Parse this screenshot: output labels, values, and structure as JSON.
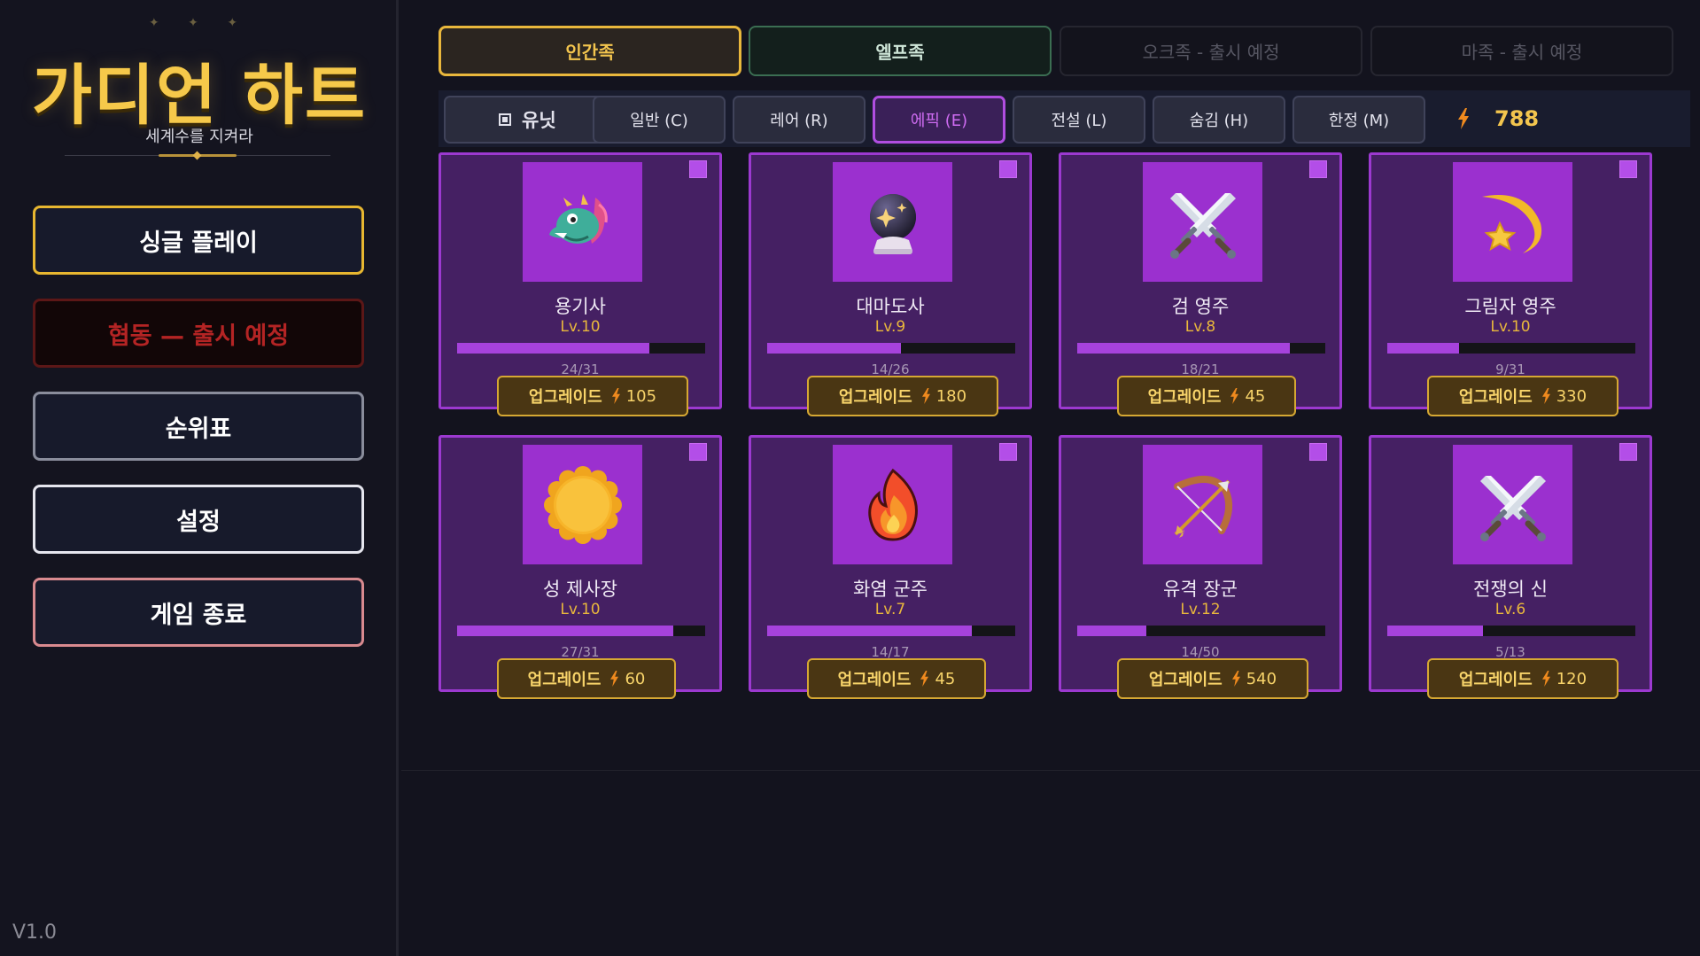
{
  "sidebar": {
    "stars": "✦ ✦ ✦",
    "title": "가디언 하트",
    "subtitle": "세계수를 지켜라",
    "menu": {
      "single": "싱글 플레이",
      "coop": "협동 — 출시 예정",
      "ranking": "순위표",
      "settings": "설정",
      "quit": "게임 종료"
    },
    "version": "V1.0"
  },
  "race_tabs": [
    {
      "label": "인간족",
      "state": "selected"
    },
    {
      "label": "엘프족",
      "state": "available"
    },
    {
      "label": "오크족 - 출시 예정",
      "state": "disabled"
    },
    {
      "label": "마족 - 출시 예정",
      "state": "disabled"
    }
  ],
  "filters": {
    "unit": "유닛",
    "items": [
      "일반 (C)",
      "레어 (R)",
      "에픽 (E)",
      "전설 (L)",
      "숨김 (H)",
      "한정 (M)"
    ],
    "active": "에픽 (E)"
  },
  "currency": {
    "icon": "lightning-icon",
    "amount": "788"
  },
  "colors": {
    "gold": "#e9b73c",
    "epic": "#b04ee0",
    "card_bg": "#452063",
    "portrait_bg": "#9b30cf"
  },
  "upgrade_label": "업그레이드",
  "units": [
    {
      "name": "용기사",
      "level": "Lv.10",
      "progress": "24/31",
      "fill": 0.774,
      "cost": "105",
      "icon": "dragon-icon"
    },
    {
      "name": "대마도사",
      "level": "Lv.9",
      "progress": "14/26",
      "fill": 0.538,
      "cost": "180",
      "icon": "crystal-ball-icon"
    },
    {
      "name": "검 영주",
      "level": "Lv.8",
      "progress": "18/21",
      "fill": 0.857,
      "cost": "45",
      "icon": "crossed-swords-icon"
    },
    {
      "name": "그림자 영주",
      "level": "Lv.10",
      "progress": "9/31",
      "fill": 0.29,
      "cost": "330",
      "icon": "shooting-star-icon"
    },
    {
      "name": "성 제사장",
      "level": "Lv.10",
      "progress": "27/31",
      "fill": 0.871,
      "cost": "60",
      "icon": "sun-icon"
    },
    {
      "name": "화염 군주",
      "level": "Lv.7",
      "progress": "14/17",
      "fill": 0.824,
      "cost": "45",
      "icon": "fire-icon"
    },
    {
      "name": "유격 장군",
      "level": "Lv.12",
      "progress": "14/50",
      "fill": 0.28,
      "cost": "540",
      "icon": "bow-and-arrow-icon"
    },
    {
      "name": "전쟁의 신",
      "level": "Lv.6",
      "progress": "5/13",
      "fill": 0.385,
      "cost": "120",
      "icon": "crossed-swords-icon"
    }
  ]
}
